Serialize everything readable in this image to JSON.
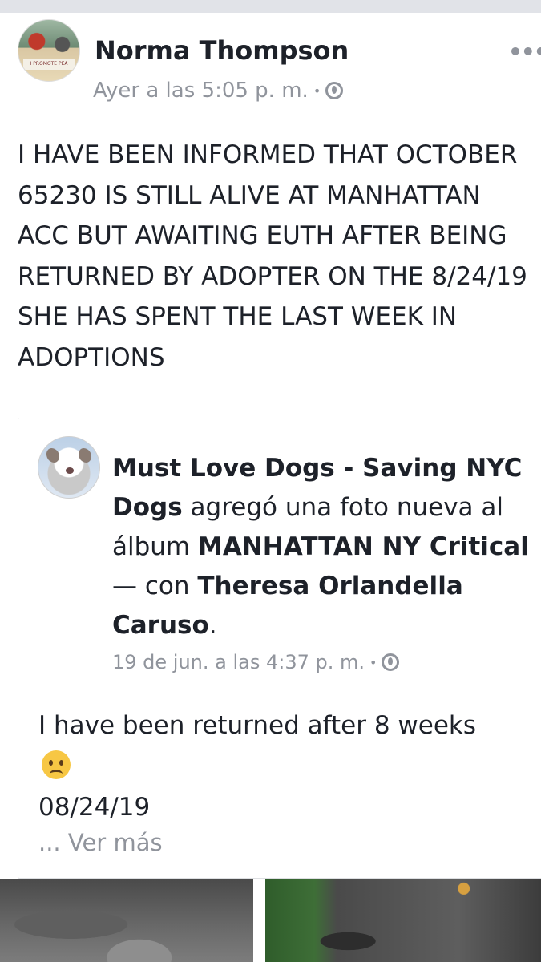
{
  "post": {
    "author": "Norma Thompson",
    "avatar_caption": "I PROMOTE PEA",
    "time": "Ayer a las 5:05 p. m.",
    "separator": "•",
    "privacy_icon": "globe-icon",
    "more_icon": "more-dots-icon",
    "more_label": "•••",
    "text": "I HAVE BEEN INFORMED THAT OCTOBER 65230  IS STILL ALIVE AT MANHATTAN ACC BUT AWAITING EUTH AFTER BEING RETURNED BY ADOPTER ON THE 8/24/19  SHE HAS SPENT THE LAST WEEK IN ADOPTIONS"
  },
  "shared": {
    "page_name": "Must Love Dogs - Saving NYC Dogs",
    "action": " agregó una foto nueva al álbum ",
    "album": "MANHATTAN NY Critical",
    "with_text": " — con ",
    "tagged": "Theresa Orlandella Caruso",
    "end_punct": ".",
    "time": "19 de jun. a las 4:37 p. m.",
    "separator": "•",
    "privacy_icon": "globe-icon",
    "body_line1": "I have been returned after 8 weeks",
    "emoji": "sad-face-emoji",
    "body_line2": "08/24/19",
    "see_more_dots": "...",
    "see_more": "Ver más"
  },
  "photos": [
    {
      "name": "dog-photo-1"
    },
    {
      "name": "dog-photo-2"
    }
  ]
}
